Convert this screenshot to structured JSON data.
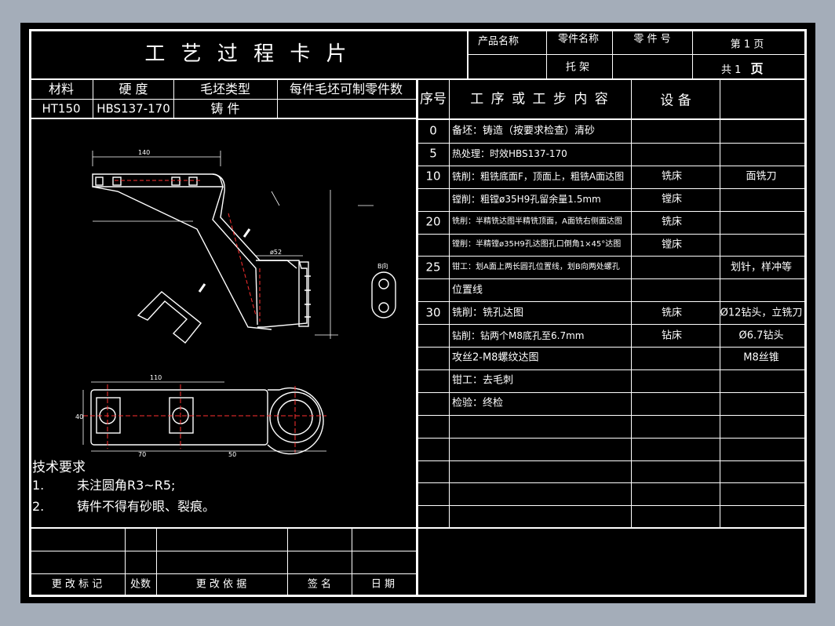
{
  "header": {
    "title": "工 艺 过 程 卡 片",
    "product_name_label": "产品名称",
    "part_name_label": "零件名称",
    "part_no_label": "零 件 号",
    "page_label": "第 1 页",
    "total_label": "共 1",
    "total_suffix": "页",
    "part_name_value": "托 架"
  },
  "material": {
    "labels": [
      "材料",
      "硬 度",
      "毛坯类型",
      "每件毛坯可制零件数"
    ],
    "values": [
      "HT150",
      "HBS137-170",
      "铸 件",
      ""
    ]
  },
  "process_header": {
    "seq": "序号",
    "content": "工 序 或 工 步 内 容",
    "equipment": "设 备"
  },
  "process_rows": [
    {
      "seq": "0",
      "content": "备坯：铸造（按要求检查）清砂",
      "equip": "",
      "tool": ""
    },
    {
      "seq": "5",
      "content": "热处理：时效HBS137-170",
      "equip": "",
      "tool": ""
    },
    {
      "seq": "10",
      "content": "铣削：粗铣底面F，顶面上，粗铣A面达图",
      "equip": "铣床",
      "tool": "面铣刀"
    },
    {
      "seq": "",
      "content": "镗削：粗镗ø35H9孔留余量1.5mm",
      "equip": "镗床",
      "tool": ""
    },
    {
      "seq": "20",
      "content": "铣削：半精铣达图半精铣顶面，A面铣右侧面达图",
      "equip": "铣床",
      "tool": ""
    },
    {
      "seq": "",
      "content": "镗削：半精镗ø35H9孔达图孔口倒角1×45°达图",
      "equip": "镗床",
      "tool": ""
    },
    {
      "seq": "25",
      "content": "钳工：划A面上两长圆孔位置线，划B向两处螺孔",
      "equip": "",
      "tool": "划针，样冲等"
    },
    {
      "seq": "",
      "content": "位置线",
      "equip": "",
      "tool": ""
    },
    {
      "seq": "30",
      "content": "铣削：铣孔达图",
      "equip": "铣床",
      "tool": "Ø12钻头，立铣刀"
    },
    {
      "seq": "",
      "content": "钻削：钻两个M8底孔至6.7mm",
      "equip": "钻床",
      "tool": "Ø6.7钻头"
    },
    {
      "seq": "",
      "content": "攻丝2-M8螺纹达图",
      "equip": "",
      "tool": "M8丝锥"
    },
    {
      "seq": "",
      "content": "钳工：去毛刺",
      "equip": "",
      "tool": ""
    },
    {
      "seq": "",
      "content": "检验：终检",
      "equip": "",
      "tool": ""
    },
    {
      "seq": "",
      "content": "",
      "equip": "",
      "tool": ""
    },
    {
      "seq": "",
      "content": "",
      "equip": "",
      "tool": ""
    },
    {
      "seq": "",
      "content": "",
      "equip": "",
      "tool": ""
    },
    {
      "seq": "",
      "content": "",
      "equip": "",
      "tool": ""
    },
    {
      "seq": "",
      "content": "",
      "equip": "",
      "tool": ""
    }
  ],
  "tech_req": {
    "title": "技术要求",
    "items": [
      {
        "num": "1.",
        "text": "未注圆角R3~R5;"
      },
      {
        "num": "2.",
        "text": "铸件不得有砂眼、裂痕。"
      }
    ]
  },
  "footer": {
    "labels": [
      "更 改 标 记",
      "处数",
      "更 改 依 据",
      "签 名",
      "日 期"
    ]
  },
  "drawing": {
    "colors": {
      "line": "#ffffff",
      "cut": "#ff3030",
      "centerline": "#ff3030"
    },
    "dims": {
      "top_len": "110",
      "seg1": "70",
      "seg2": "50",
      "height": "40",
      "dia": "ø52",
      "b_view": "B向",
      "bottom_len": "140"
    }
  }
}
